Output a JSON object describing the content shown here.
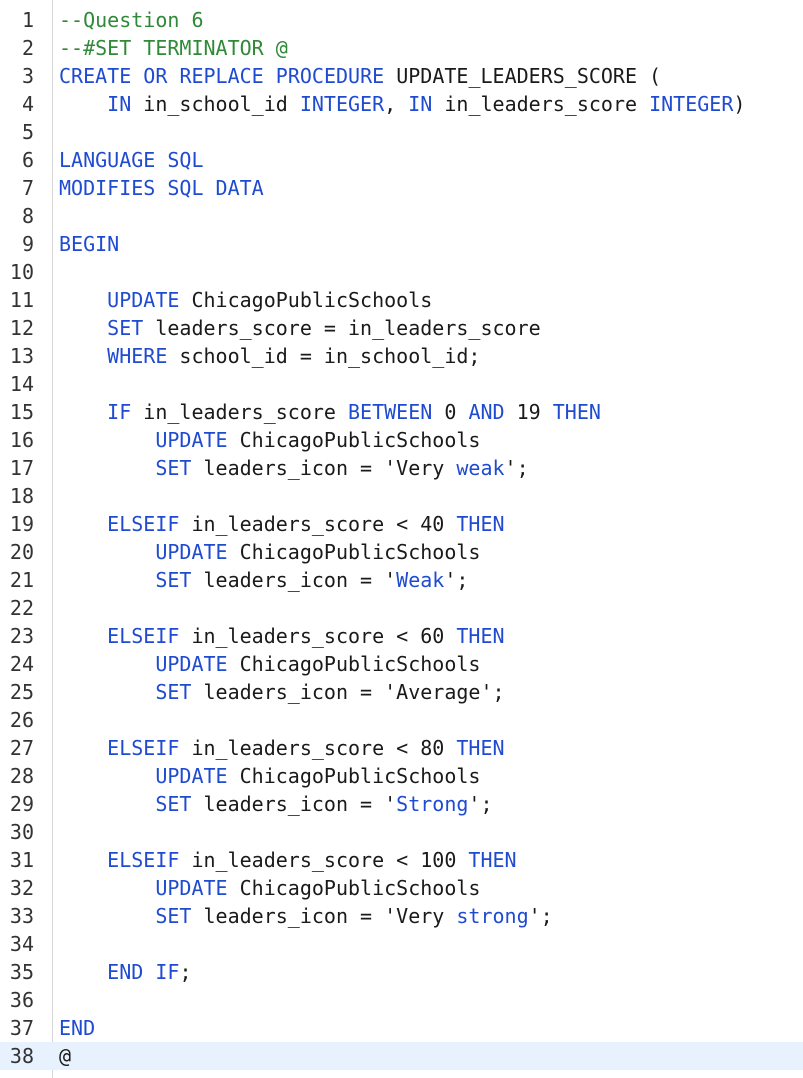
{
  "colors": {
    "keyword": "#1f4bd1",
    "comment": "#2f8a38",
    "text": "#1a1a1a",
    "active_line_bg": "#e8f2ff"
  },
  "active_line": 38,
  "lines": [
    [
      [
        "comment",
        "--Question 6"
      ]
    ],
    [
      [
        "comment",
        "--#SET TERMINATOR @"
      ]
    ],
    [
      [
        "kw",
        "CREATE"
      ],
      [
        "t",
        " "
      ],
      [
        "kw",
        "OR"
      ],
      [
        "t",
        " "
      ],
      [
        "kw",
        "REPLACE"
      ],
      [
        "t",
        " "
      ],
      [
        "kw",
        "PROCEDURE"
      ],
      [
        "t",
        " UPDATE_LEADERS_SCORE ("
      ]
    ],
    [
      [
        "t",
        "    "
      ],
      [
        "kw",
        "IN"
      ],
      [
        "t",
        " in_school_id "
      ],
      [
        "kw",
        "INTEGER"
      ],
      [
        "t",
        ", "
      ],
      [
        "kw",
        "IN"
      ],
      [
        "t",
        " in_leaders_score "
      ],
      [
        "kw",
        "INTEGER"
      ],
      [
        "t",
        ")"
      ]
    ],
    [],
    [
      [
        "kw",
        "LANGUAGE"
      ],
      [
        "t",
        " "
      ],
      [
        "kw",
        "SQL"
      ]
    ],
    [
      [
        "kw",
        "MODIFIES"
      ],
      [
        "t",
        " "
      ],
      [
        "kw",
        "SQL"
      ],
      [
        "t",
        " "
      ],
      [
        "kw",
        "DATA"
      ]
    ],
    [],
    [
      [
        "kw",
        "BEGIN"
      ]
    ],
    [],
    [
      [
        "t",
        "    "
      ],
      [
        "kw",
        "UPDATE"
      ],
      [
        "t",
        " ChicagoPublicSchools"
      ]
    ],
    [
      [
        "t",
        "    "
      ],
      [
        "kw",
        "SET"
      ],
      [
        "t",
        " leaders_score = in_leaders_score"
      ]
    ],
    [
      [
        "t",
        "    "
      ],
      [
        "kw",
        "WHERE"
      ],
      [
        "t",
        " school_id = in_school_id;"
      ]
    ],
    [],
    [
      [
        "t",
        "    "
      ],
      [
        "kw",
        "IF"
      ],
      [
        "t",
        " in_leaders_score "
      ],
      [
        "kw",
        "BETWEEN"
      ],
      [
        "t",
        " 0 "
      ],
      [
        "kw",
        "AND"
      ],
      [
        "t",
        " 19 "
      ],
      [
        "kw",
        "THEN"
      ]
    ],
    [
      [
        "t",
        "        "
      ],
      [
        "kw",
        "UPDATE"
      ],
      [
        "t",
        " ChicagoPublicSchools"
      ]
    ],
    [
      [
        "t",
        "        "
      ],
      [
        "kw",
        "SET"
      ],
      [
        "t",
        " leaders_icon = 'Very "
      ],
      [
        "kw",
        "weak"
      ],
      [
        "t",
        "';"
      ]
    ],
    [],
    [
      [
        "t",
        "    "
      ],
      [
        "kw",
        "ELSEIF"
      ],
      [
        "t",
        " in_leaders_score < 40 "
      ],
      [
        "kw",
        "THEN"
      ]
    ],
    [
      [
        "t",
        "        "
      ],
      [
        "kw",
        "UPDATE"
      ],
      [
        "t",
        " ChicagoPublicSchools"
      ]
    ],
    [
      [
        "t",
        "        "
      ],
      [
        "kw",
        "SET"
      ],
      [
        "t",
        " leaders_icon = '"
      ],
      [
        "kw",
        "Weak"
      ],
      [
        "t",
        "';"
      ]
    ],
    [],
    [
      [
        "t",
        "    "
      ],
      [
        "kw",
        "ELSEIF"
      ],
      [
        "t",
        " in_leaders_score < 60 "
      ],
      [
        "kw",
        "THEN"
      ]
    ],
    [
      [
        "t",
        "        "
      ],
      [
        "kw",
        "UPDATE"
      ],
      [
        "t",
        " ChicagoPublicSchools"
      ]
    ],
    [
      [
        "t",
        "        "
      ],
      [
        "kw",
        "SET"
      ],
      [
        "t",
        " leaders_icon = 'Average';"
      ]
    ],
    [],
    [
      [
        "t",
        "    "
      ],
      [
        "kw",
        "ELSEIF"
      ],
      [
        "t",
        " in_leaders_score < 80 "
      ],
      [
        "kw",
        "THEN"
      ]
    ],
    [
      [
        "t",
        "        "
      ],
      [
        "kw",
        "UPDATE"
      ],
      [
        "t",
        " ChicagoPublicSchools"
      ]
    ],
    [
      [
        "t",
        "        "
      ],
      [
        "kw",
        "SET"
      ],
      [
        "t",
        " leaders_icon = '"
      ],
      [
        "kw",
        "Strong"
      ],
      [
        "t",
        "';"
      ]
    ],
    [],
    [
      [
        "t",
        "    "
      ],
      [
        "kw",
        "ELSEIF"
      ],
      [
        "t",
        " in_leaders_score < 100 "
      ],
      [
        "kw",
        "THEN"
      ]
    ],
    [
      [
        "t",
        "        "
      ],
      [
        "kw",
        "UPDATE"
      ],
      [
        "t",
        " ChicagoPublicSchools"
      ]
    ],
    [
      [
        "t",
        "        "
      ],
      [
        "kw",
        "SET"
      ],
      [
        "t",
        " leaders_icon = 'Very "
      ],
      [
        "kw",
        "strong"
      ],
      [
        "t",
        "';"
      ]
    ],
    [],
    [
      [
        "t",
        "    "
      ],
      [
        "kw",
        "END"
      ],
      [
        "t",
        " "
      ],
      [
        "kw",
        "IF"
      ],
      [
        "t",
        ";"
      ]
    ],
    [],
    [
      [
        "kw",
        "END"
      ]
    ],
    [
      [
        "t",
        "@"
      ]
    ]
  ]
}
